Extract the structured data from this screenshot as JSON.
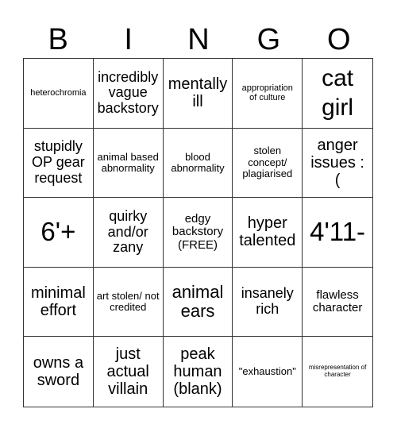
{
  "header": [
    "B",
    "I",
    "N",
    "G",
    "O"
  ],
  "cells": [
    "heterochromia",
    "incredibly vague backstory",
    "mentally ill",
    "appropriation of culture",
    "cat girl",
    "stupidly OP gear request",
    "animal based abnormality",
    "blood abnormality",
    "stolen concept/ plagiarised",
    "anger issues :(",
    "6'+",
    "quirky and/or zany",
    "edgy backstory (FREE)",
    "hyper talented",
    "4'11-",
    "minimal effort",
    "art stolen/ not credited",
    "animal ears",
    "insanely rich",
    "flawless character",
    "owns a sword",
    "just actual villain",
    "peak human (blank)",
    "\"exhaustion\"",
    "misrepresentation of character"
  ]
}
